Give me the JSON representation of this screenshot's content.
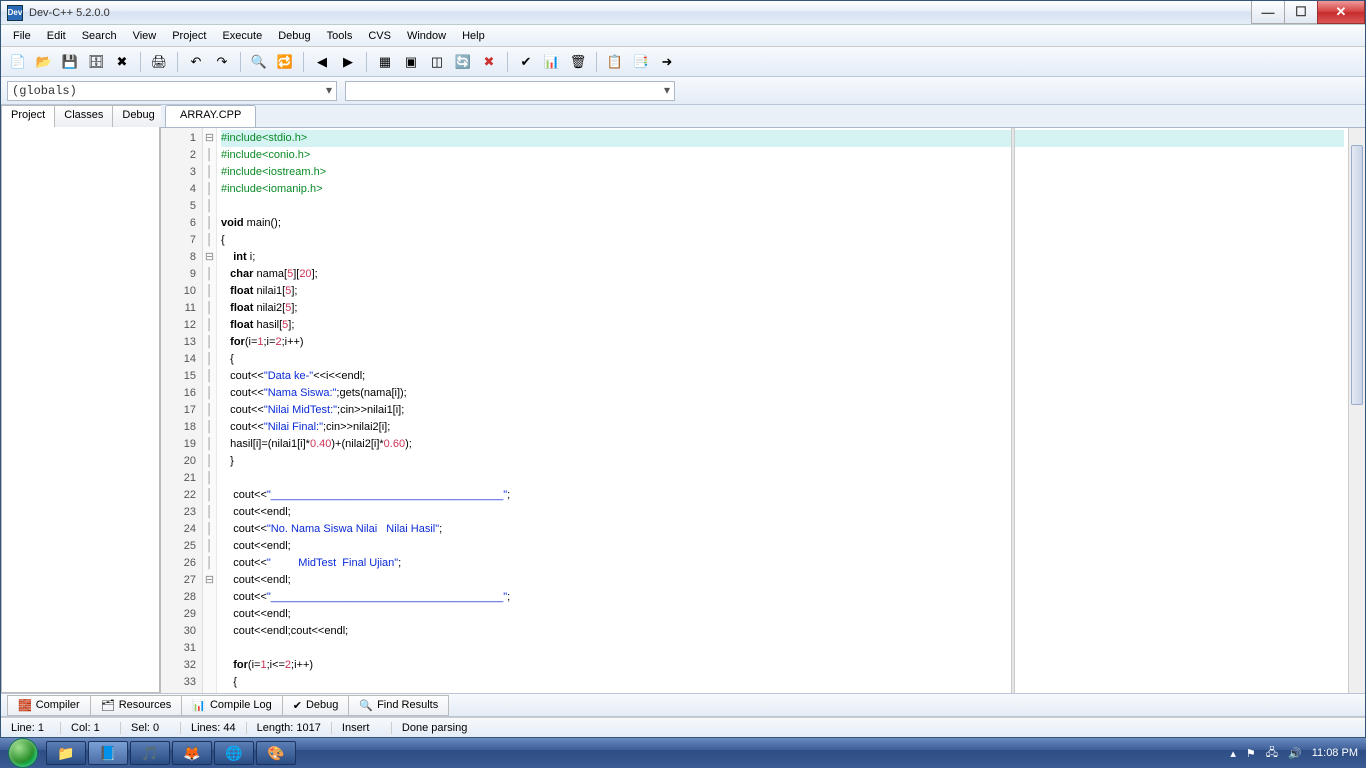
{
  "window": {
    "title": "Dev-C++ 5.2.0.0"
  },
  "menu": [
    "File",
    "Edit",
    "Search",
    "View",
    "Project",
    "Execute",
    "Debug",
    "Tools",
    "CVS",
    "Window",
    "Help"
  ],
  "globals_combo": "(globals)",
  "left_tabs": [
    "Project",
    "Classes",
    "Debug"
  ],
  "editor_tab": "ARRAY.CPP",
  "code": {
    "lines": [
      {
        "n": 1,
        "fold": "",
        "hl": true,
        "html": "<span class='pp'>#include&lt;stdio.h&gt;</span>"
      },
      {
        "n": 2,
        "fold": "",
        "html": "<span class='pp'>#include&lt;conio.h&gt;</span>"
      },
      {
        "n": 3,
        "fold": "",
        "html": "<span class='pp'>#include&lt;iostream.h&gt;</span>"
      },
      {
        "n": 4,
        "fold": "",
        "html": "<span class='pp'>#include&lt;iomanip.h&gt;</span>"
      },
      {
        "n": 5,
        "fold": "",
        "html": ""
      },
      {
        "n": 6,
        "fold": "",
        "html": "<span class='kw'>void</span> main();"
      },
      {
        "n": 7,
        "fold": "⊟",
        "html": "{"
      },
      {
        "n": 8,
        "fold": "│",
        "html": "    <span class='kw'>int</span> i;"
      },
      {
        "n": 9,
        "fold": "│",
        "html": "   <span class='kw'>char</span> nama[<span class='num'>5</span>][<span class='num'>20</span>];"
      },
      {
        "n": 10,
        "fold": "│",
        "html": "   <span class='kw'>float</span> nilai1[<span class='num'>5</span>];"
      },
      {
        "n": 11,
        "fold": "│",
        "html": "   <span class='kw'>float</span> nilai2[<span class='num'>5</span>];"
      },
      {
        "n": 12,
        "fold": "│",
        "html": "   <span class='kw'>float</span> hasil[<span class='num'>5</span>];"
      },
      {
        "n": 13,
        "fold": "│",
        "html": "   <span class='kw'>for</span>(i=<span class='num'>1</span>;i=<span class='num'>2</span>;i++)"
      },
      {
        "n": 14,
        "fold": "⊟",
        "html": "   {"
      },
      {
        "n": 15,
        "fold": "│",
        "html": "   cout&lt;&lt;<span class='str'>\"Data ke-\"</span>&lt;&lt;i&lt;&lt;endl;"
      },
      {
        "n": 16,
        "fold": "│",
        "html": "   cout&lt;&lt;<span class='str'>\"Nama Siswa:\"</span>;gets(nama[i]);"
      },
      {
        "n": 17,
        "fold": "│",
        "html": "   cout&lt;&lt;<span class='str'>\"Nilai MidTest:\"</span>;cin&gt;&gt;nilai1[i];"
      },
      {
        "n": 18,
        "fold": "│",
        "html": "   cout&lt;&lt;<span class='str'>\"Nilai Final:\"</span>;cin&gt;&gt;nilai2[i];"
      },
      {
        "n": 19,
        "fold": "│",
        "html": "   hasil[i]=(nilai1[i]*<span class='num'>0.40</span>)+(nilai2[i]*<span class='num'>0.60</span>);"
      },
      {
        "n": 20,
        "fold": "│",
        "html": "   }"
      },
      {
        "n": 21,
        "fold": "│",
        "html": ""
      },
      {
        "n": 22,
        "fold": "│",
        "html": "    cout&lt;&lt;<span class='str'>\"______________________________________\"</span>;"
      },
      {
        "n": 23,
        "fold": "│",
        "html": "    cout&lt;&lt;endl;"
      },
      {
        "n": 24,
        "fold": "│",
        "html": "    cout&lt;&lt;<span class='str'>\"No. Nama Siswa Nilai   Nilai Hasil\"</span>;"
      },
      {
        "n": 25,
        "fold": "│",
        "html": "    cout&lt;&lt;endl;"
      },
      {
        "n": 26,
        "fold": "│",
        "html": "    cout&lt;&lt;<span class='str'>\"         MidTest  Final Ujian\"</span>;"
      },
      {
        "n": 27,
        "fold": "│",
        "html": "    cout&lt;&lt;endl;"
      },
      {
        "n": 28,
        "fold": "│",
        "html": "    cout&lt;&lt;<span class='str'>\"______________________________________\"</span>;"
      },
      {
        "n": 29,
        "fold": "│",
        "html": "    cout&lt;&lt;endl;"
      },
      {
        "n": 30,
        "fold": "│",
        "html": "    cout&lt;&lt;endl;cout&lt;&lt;endl;"
      },
      {
        "n": 31,
        "fold": "│",
        "html": ""
      },
      {
        "n": 32,
        "fold": "│",
        "html": "    <span class='kw'>for</span>(i=<span class='num'>1</span>;i&lt;=<span class='num'>2</span>;i++)"
      },
      {
        "n": 33,
        "fold": "⊟",
        "html": "    {"
      }
    ]
  },
  "bottom_tabs": [
    {
      "icon": "🧱",
      "label": "Compiler"
    },
    {
      "icon": "🗂",
      "label": "Resources"
    },
    {
      "icon": "📊",
      "label": "Compile Log"
    },
    {
      "icon": "✔",
      "label": "Debug"
    },
    {
      "icon": "🔍",
      "label": "Find Results"
    }
  ],
  "status": {
    "line": "Line:   1",
    "col": "Col:   1",
    "sel": "Sel:   0",
    "lines": "Lines:   44",
    "length": "Length:  1017",
    "mode": "Insert",
    "parse": "Done parsing"
  },
  "taskbar": {
    "time": "11:08 PM"
  }
}
